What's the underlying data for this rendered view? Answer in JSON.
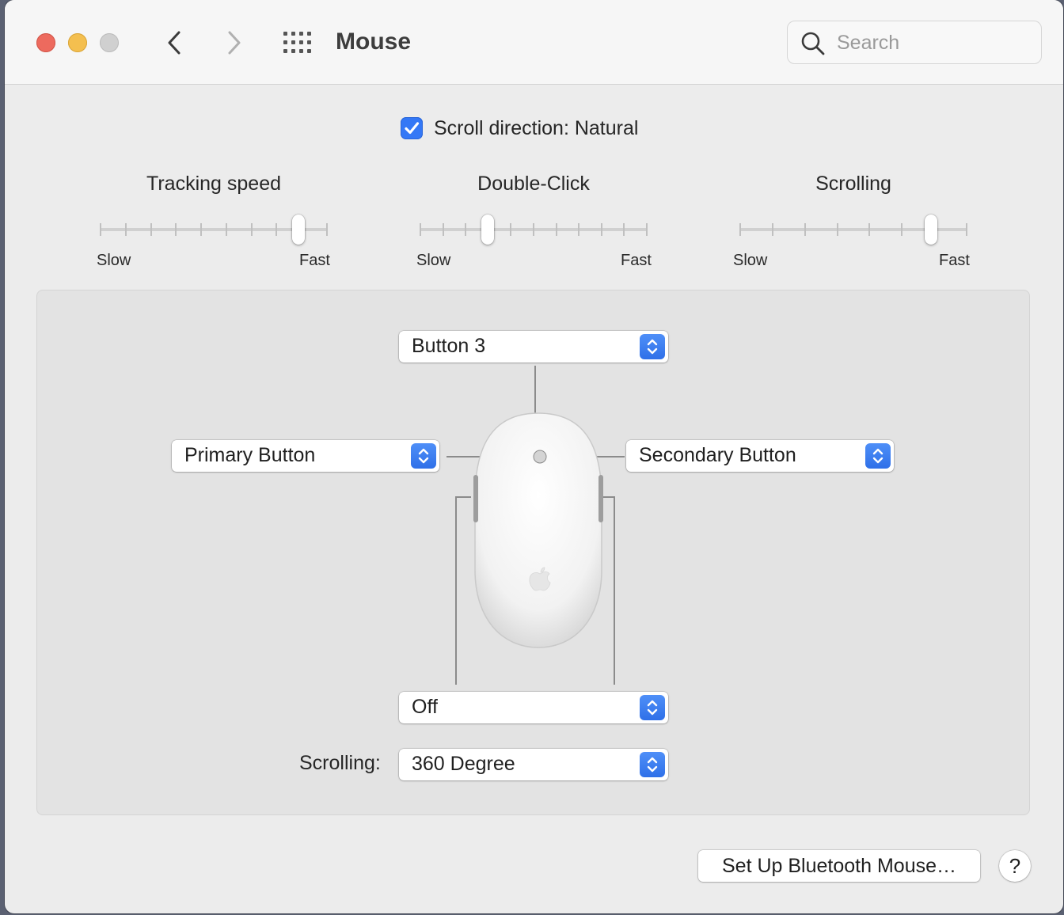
{
  "window": {
    "title": "Mouse",
    "traffic_lights": {
      "close": "#ed6a5e",
      "minimize": "#f4bf4f",
      "zoom": "#d0d0d0"
    }
  },
  "toolbar": {
    "back_icon": "chevron-left-icon",
    "forward_icon": "chevron-right-icon",
    "grid_icon": "show-all-grid-icon",
    "search_placeholder": "Search"
  },
  "scroll_direction": {
    "label": "Scroll direction: Natural",
    "checked": true,
    "accent": "#3478f6"
  },
  "sliders": [
    {
      "title": "Tracking speed",
      "min_label": "Slow",
      "max_label": "Fast",
      "ticks": 10,
      "position": 0.87
    },
    {
      "title": "Double-Click",
      "min_label": "Slow",
      "max_label": "Fast",
      "ticks": 11,
      "position": 0.3
    },
    {
      "title": "Scrolling",
      "min_label": "Slow",
      "max_label": "Fast",
      "ticks": 8,
      "position": 0.84
    }
  ],
  "buttons_panel": {
    "top_popup": "Button 3",
    "left_popup": "Primary Button",
    "right_popup": "Secondary Button",
    "side_popup": "Off",
    "scrolling_label": "Scrolling:",
    "scrolling_popup": "360 Degree"
  },
  "footer": {
    "setup_button": "Set Up Bluetooth Mouse…",
    "help_button": "?"
  }
}
